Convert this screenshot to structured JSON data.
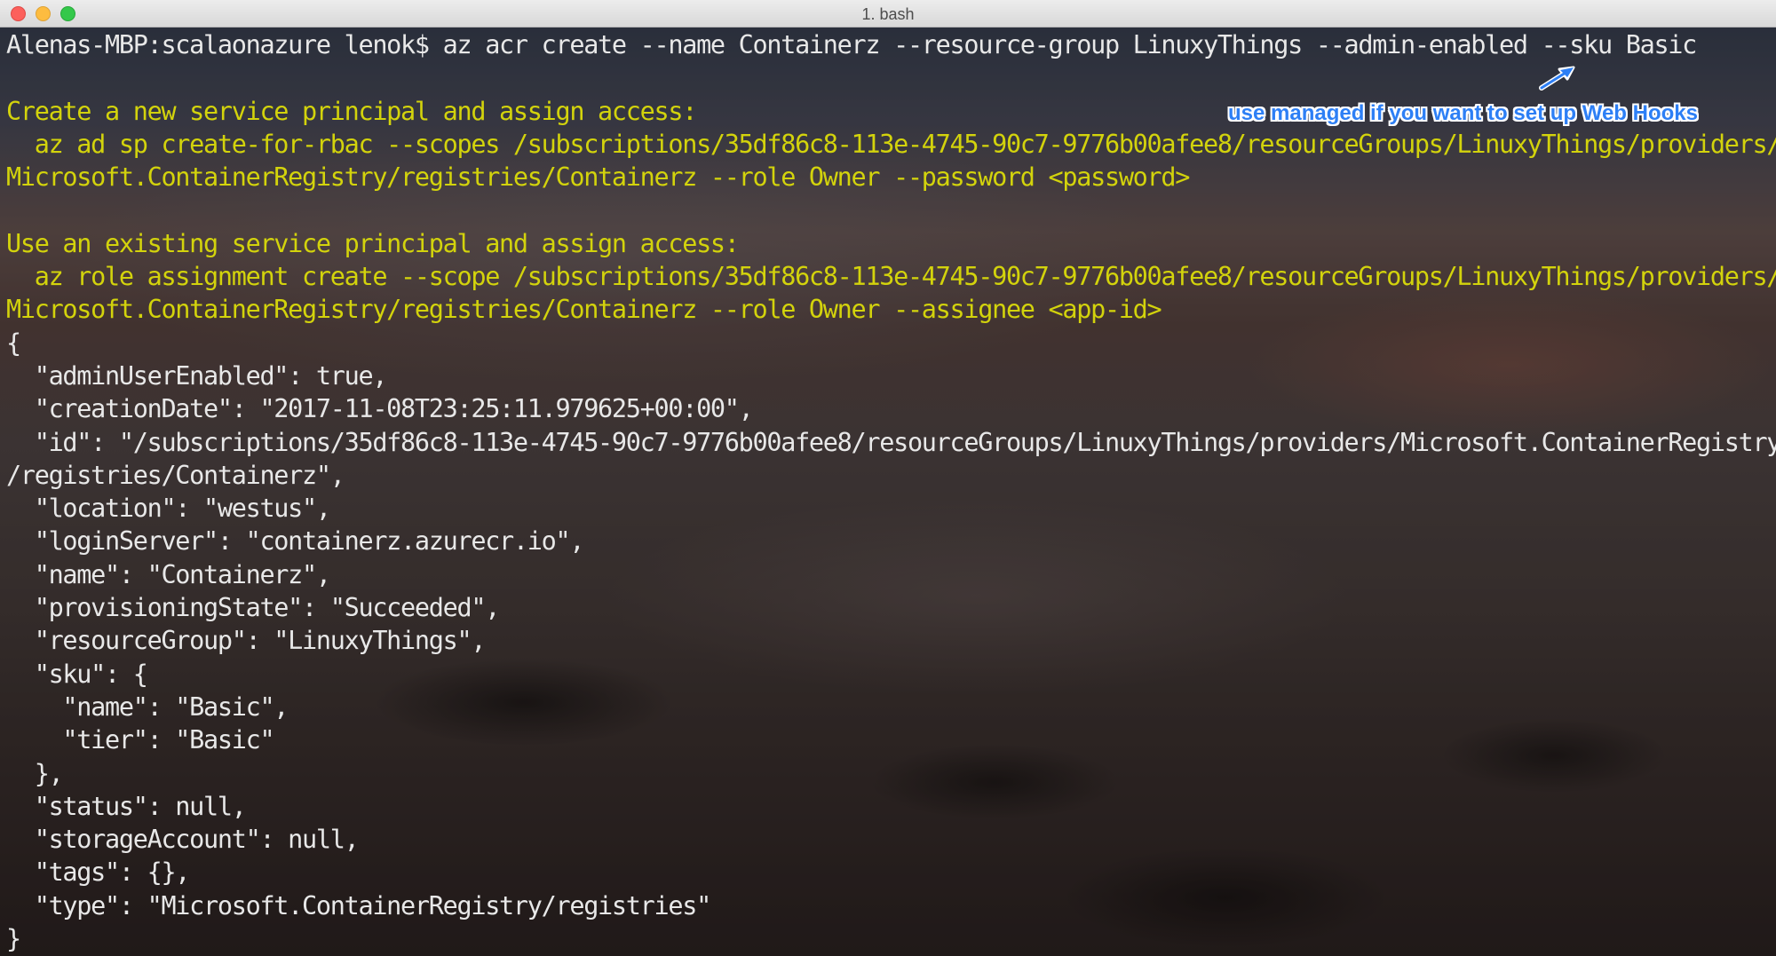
{
  "window": {
    "title": "1. bash"
  },
  "annotation": {
    "text": "use managed if you want to set up Web Hooks",
    "color": "#2d7ff5"
  },
  "colors": {
    "text": "#e8e8e8",
    "warning": "#d3d30c"
  },
  "terminal": {
    "lines": [
      "Alenas-MBP:scalaonazure lenok$ az acr create --name Containerz --resource-group LinuxyThings --admin-enabled --sku Basic",
      "",
      "Create a new service principal and assign access:",
      "  az ad sp create-for-rbac --scopes /subscriptions/35df86c8-113e-4745-90c7-9776b00afee8/resourceGroups/LinuxyThings/providers/",
      "Microsoft.ContainerRegistry/registries/Containerz --role Owner --password <password>",
      "",
      "Use an existing service principal and assign access:",
      "  az role assignment create --scope /subscriptions/35df86c8-113e-4745-90c7-9776b00afee8/resourceGroups/LinuxyThings/providers/",
      "Microsoft.ContainerRegistry/registries/Containerz --role Owner --assignee <app-id>",
      "{",
      "  \"adminUserEnabled\": true,",
      "  \"creationDate\": \"2017-11-08T23:25:11.979625+00:00\",",
      "  \"id\": \"/subscriptions/35df86c8-113e-4745-90c7-9776b00afee8/resourceGroups/LinuxyThings/providers/Microsoft.ContainerRegistry",
      "/registries/Containerz\",",
      "  \"location\": \"westus\",",
      "  \"loginServer\": \"containerz.azurecr.io\",",
      "  \"name\": \"Containerz\",",
      "  \"provisioningState\": \"Succeeded\",",
      "  \"resourceGroup\": \"LinuxyThings\",",
      "  \"sku\": {",
      "    \"name\": \"Basic\",",
      "    \"tier\": \"Basic\"",
      "  },",
      "  \"status\": null,",
      "  \"storageAccount\": null,",
      "  \"tags\": {},",
      "  \"type\": \"Microsoft.ContainerRegistry/registries\"",
      "}"
    ]
  }
}
